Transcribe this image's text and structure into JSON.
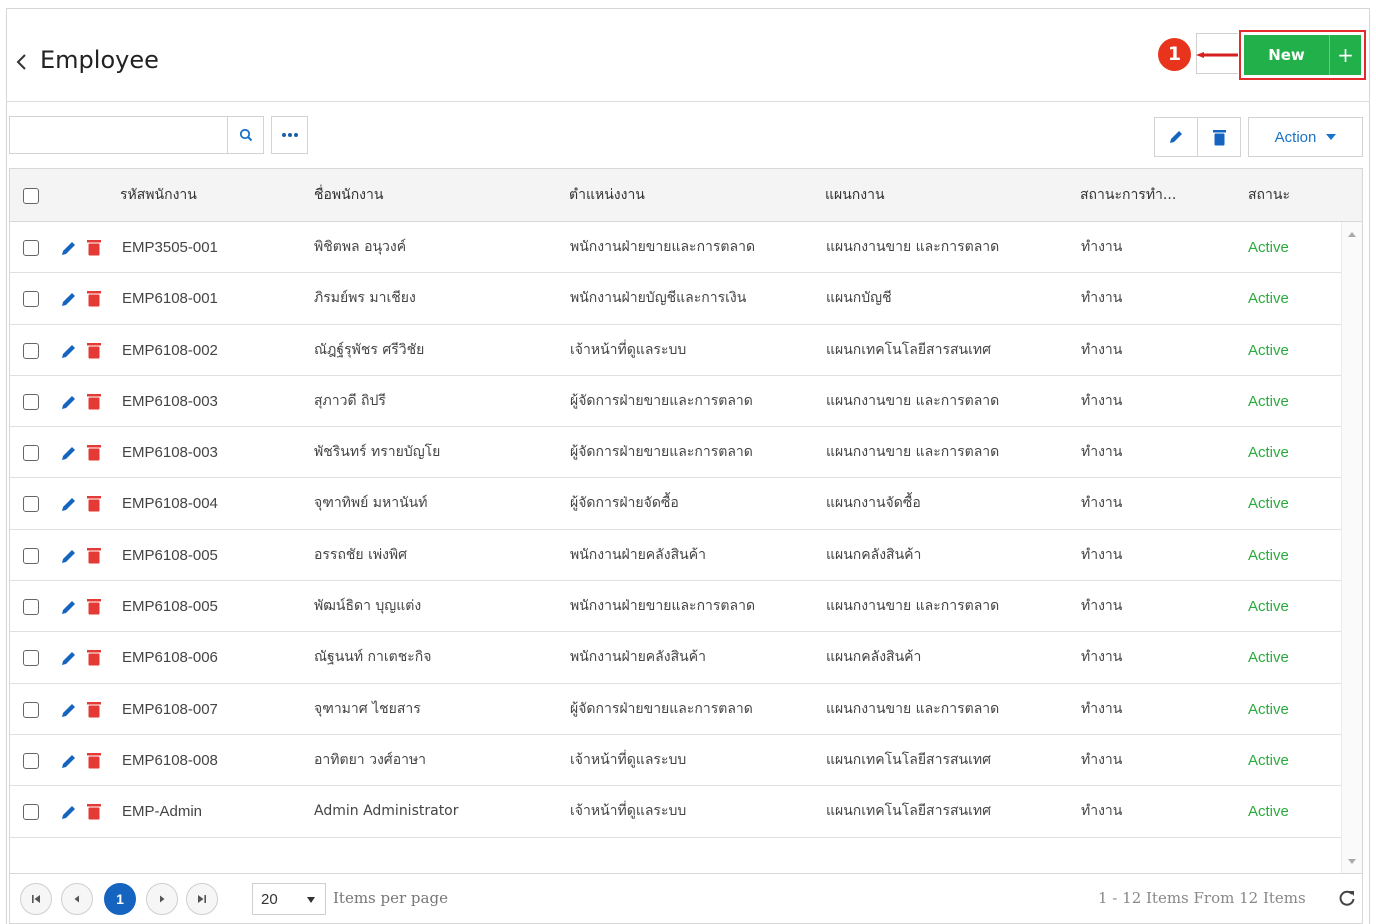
{
  "header": {
    "title": "Employee",
    "callout_number": "1",
    "new_button_label": "New",
    "new_plus": "+"
  },
  "toolbar": {
    "search_placeholder": "",
    "more_label": "•••",
    "action_label": "Action"
  },
  "table": {
    "columns": [
      "รหัสพนักงาน",
      "ชื่อพนักงาน",
      "ตำแหน่งงาน",
      "แผนกงาน",
      "สถานะการทำ...",
      "สถานะ"
    ],
    "rows": [
      [
        "EMP3505-001",
        "พิชิตพล อนุวงค์",
        "พนักงานฝ่ายขายและการตลาด",
        "แผนกงานขาย และการตลาด",
        "ทำงาน",
        "Active"
      ],
      [
        "EMP6108-001",
        "ภิรมย์พร มาเชียง",
        "พนักงานฝ่ายบัญชีและการเงิน",
        "แผนกบัญชี",
        "ทำงาน",
        "Active"
      ],
      [
        "EMP6108-002",
        "ณัฎฐ์รุพัชร ศรีวิชัย",
        "เจ้าหน้าที่ดูแลระบบ",
        "แผนกเทคโนโลยีสารสนเทศ",
        "ทำงาน",
        "Active"
      ],
      [
        "EMP6108-003",
        "สุภาวดี ถิปรี",
        "ผู้จัดการฝ่ายขายและการตลาด",
        "แผนกงานขาย และการตลาด",
        "ทำงาน",
        "Active"
      ],
      [
        "EMP6108-003",
        "พัชรินทร์ ทรายบัญโย",
        "ผู้จัดการฝ่ายขายและการตลาด",
        "แผนกงานขาย และการตลาด",
        "ทำงาน",
        "Active"
      ],
      [
        "EMP6108-004",
        "จุฑาทิพย์ มหานันท์",
        "ผู้จัดการฝ่ายจัดซื้อ",
        "แผนกงานจัดซื้อ",
        "ทำงาน",
        "Active"
      ],
      [
        "EMP6108-005",
        "อรรถชัย เพ่งพิศ",
        "พนักงานฝ่ายคลังสินค้า",
        "แผนกคลังสินค้า",
        "ทำงาน",
        "Active"
      ],
      [
        "EMP6108-005",
        "พัฒน์ธิดา บุญแต่ง",
        "พนักงานฝ่ายขายและการตลาด",
        "แผนกงานขาย และการตลาด",
        "ทำงาน",
        "Active"
      ],
      [
        "EMP6108-006",
        "ณัฐนนท์ กาเตชะกิจ",
        "พนักงานฝ่ายคลังสินค้า",
        "แผนกคลังสินค้า",
        "ทำงาน",
        "Active"
      ],
      [
        "EMP6108-007",
        "จุฑามาศ ไชยสาร",
        "ผู้จัดการฝ่ายขายและการตลาด",
        "แผนกงานขาย และการตลาด",
        "ทำงาน",
        "Active"
      ],
      [
        "EMP6108-008",
        "อาทิตยา วงศ์อาษา",
        "เจ้าหน้าที่ดูแลระบบ",
        "แผนกเทคโนโลยีสารสนเทศ",
        "ทำงาน",
        "Active"
      ],
      [
        "EMP-Admin",
        "Admin Administrator",
        "เจ้าหน้าที่ดูแลระบบ",
        "แผนกเทคโนโลยีสารสนเทศ",
        "ทำงาน",
        "Active"
      ]
    ]
  },
  "pager": {
    "current_page": "1",
    "page_size": "20",
    "items_per_page_label": "Items per page",
    "info": "1 - 12 Items From 12 Items"
  },
  "colors": {
    "primary_blue": "#1565c0",
    "new_green": "#22b04b",
    "active_green": "#2bab3e",
    "delete_red": "#e53935",
    "highlight_red": "#e42a2a"
  }
}
